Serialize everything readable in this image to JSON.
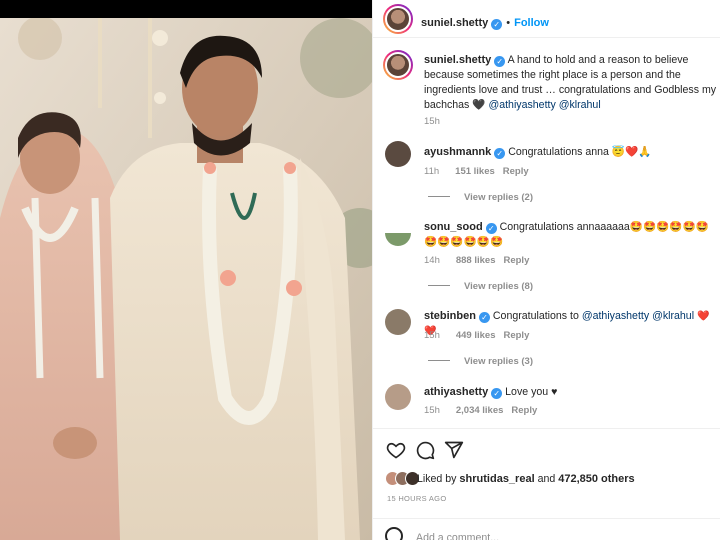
{
  "post": {
    "author": "suniel.shetty",
    "follow_label": "Follow",
    "dot": "•"
  },
  "caption": {
    "username": "suniel.shetty",
    "text": "A hand to hold and a reason to believe because sometimes the right place is a person and the ingredients love and trust … congratulations and Godbless my bachchas",
    "heart": "🖤",
    "mention1": "@athiyashetty",
    "mention2": "@klrahul",
    "time": "15h"
  },
  "comments": [
    {
      "username": "ayushmannk",
      "text": "Congratulations anna",
      "emoji": "😇❤️🙏",
      "time": "11h",
      "likes": "151 likes",
      "reply": "Reply",
      "replies": "View replies (2)"
    },
    {
      "username": "sonu_sood",
      "text": "Congratulations annaaaaaa",
      "emoji": "🤩🤩🤩🤩🤩🤩🤩🤩🤩🤩🤩🤩",
      "time": "14h",
      "likes": "888 likes",
      "reply": "Reply",
      "replies": "View replies (8)"
    },
    {
      "username": "stebinben",
      "text": "Congratulations to",
      "mention1": "@athiyashetty",
      "mention2": "@klrahul",
      "emoji": "❤️❤️",
      "time": "15h",
      "likes": "449 likes",
      "reply": "Reply",
      "replies": "View replies (3)"
    },
    {
      "username": "athiyashetty",
      "text": "Love you",
      "emoji": "♥",
      "time": "15h",
      "likes": "2,034 likes",
      "reply": "Reply"
    }
  ],
  "actions": {
    "like_icon": "heart-icon",
    "comment_icon": "comment-icon",
    "share_icon": "share-icon"
  },
  "likes_line": {
    "prefix": "Liked by",
    "user": "shrutidas_real",
    "and": "and",
    "count": "472,850 others"
  },
  "time_ago": "15 HOURS AGO",
  "add_comment": {
    "placeholder": "Add a comment..."
  },
  "colors": {
    "link": "#0095f6",
    "mention": "#00376b",
    "verified": "#3897f0",
    "heart_red": "#ed4956",
    "muted": "#8e8e8e"
  }
}
